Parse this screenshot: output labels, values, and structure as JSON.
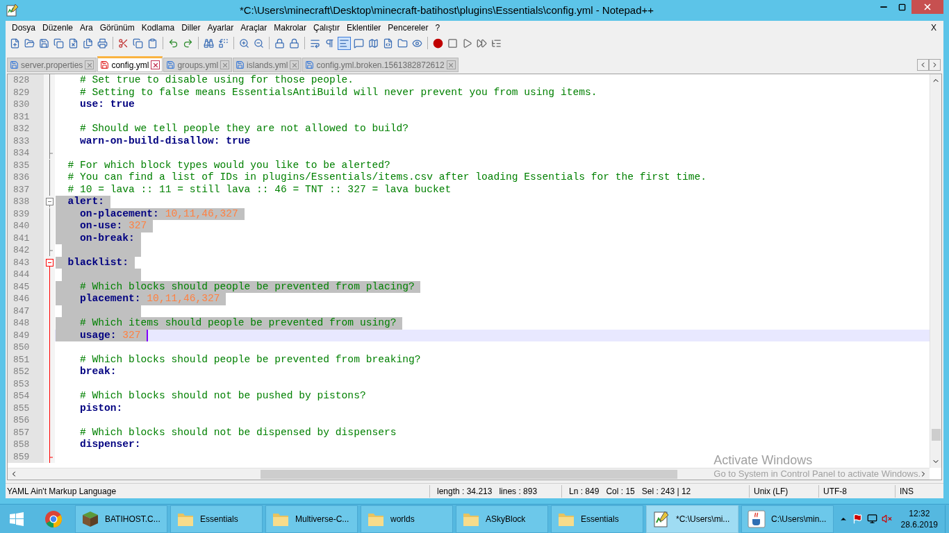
{
  "window": {
    "title": "*C:\\Users\\minecraft\\Desktop\\minecraft-batihost\\plugins\\Essentials\\config.yml - Notepad++"
  },
  "menu": {
    "items": [
      "Dosya",
      "Düzenle",
      "Ara",
      "Görünüm",
      "Kodlama",
      "Diller",
      "Ayarlar",
      "Araçlar",
      "Makrolar",
      "Çalıştır",
      "Eklentiler",
      "Pencereler",
      "?"
    ],
    "close": "X"
  },
  "tabs": [
    {
      "label": "server.properties",
      "selected": false,
      "modified": false
    },
    {
      "label": "config.yml",
      "selected": true,
      "modified": true
    },
    {
      "label": "groups.yml",
      "selected": false,
      "modified": false
    },
    {
      "label": "islands.yml",
      "selected": false,
      "modified": false
    },
    {
      "label": "config.yml.broken.1561382872612",
      "selected": false,
      "modified": false
    }
  ],
  "editor": {
    "lines": [
      {
        "number": "828",
        "fold_start": false,
        "fold_end": false,
        "fold_active": false,
        "selected": false,
        "current": false,
        "segments": [
          {
            "kind": "comment",
            "text": "    # Set true to disable using for those people."
          }
        ]
      },
      {
        "number": "829",
        "fold_start": false,
        "fold_end": false,
        "fold_active": false,
        "selected": false,
        "current": false,
        "segments": [
          {
            "kind": "comment",
            "text": "    # Setting to false means EssentialsAntiBuild will never prevent you from using items."
          }
        ]
      },
      {
        "number": "830",
        "fold_start": false,
        "fold_end": false,
        "fold_active": false,
        "selected": false,
        "current": false,
        "segments": [
          {
            "kind": "key",
            "text": "    use:"
          },
          {
            "kind": "bool",
            "text": " true"
          }
        ]
      },
      {
        "number": "831",
        "fold_start": false,
        "fold_end": false,
        "fold_active": false,
        "selected": false,
        "current": false
      },
      {
        "number": "832",
        "fold_start": false,
        "fold_end": false,
        "fold_active": false,
        "selected": false,
        "current": false,
        "segments": [
          {
            "kind": "comment",
            "text": "    # Should we tell people they are not allowed to build?"
          }
        ]
      },
      {
        "number": "833",
        "fold_start": false,
        "fold_end": false,
        "fold_active": false,
        "selected": false,
        "current": false,
        "segments": [
          {
            "kind": "key",
            "text": "    warn-on-build-disallow:"
          },
          {
            "kind": "bool",
            "text": " true"
          }
        ]
      },
      {
        "number": "834",
        "fold_start": false,
        "fold_end": true,
        "fold_active": false,
        "selected": false,
        "current": false
      },
      {
        "number": "835",
        "fold_start": false,
        "fold_end": false,
        "fold_active": false,
        "selected": false,
        "current": false,
        "segments": [
          {
            "kind": "comment",
            "text": "  # For which block types would you like to be alerted?"
          }
        ]
      },
      {
        "number": "836",
        "fold_start": false,
        "fold_end": false,
        "fold_active": false,
        "selected": false,
        "current": false,
        "segments": [
          {
            "kind": "comment",
            "text": "  # You can find a list of IDs in plugins/Essentials/items.csv after loading Essentials for the first time."
          }
        ]
      },
      {
        "number": "837",
        "fold_start": false,
        "fold_end": false,
        "fold_active": false,
        "selected": false,
        "current": false,
        "segments": [
          {
            "kind": "comment",
            "text": "  # 10 = lava :: 11 = still lava :: 46 = TNT :: 327 = lava bucket"
          }
        ]
      },
      {
        "number": "838",
        "fold_start": true,
        "fold_end": false,
        "fold_active": false,
        "selected": true,
        "current": false,
        "segments": [
          {
            "kind": "key",
            "text": "  alert:"
          }
        ]
      },
      {
        "number": "839",
        "fold_start": false,
        "fold_end": false,
        "fold_active": false,
        "selected": true,
        "current": false,
        "segments": [
          {
            "kind": "key",
            "text": "    on-placement:"
          },
          {
            "kind": "value",
            "text": " 10,11,46,327"
          }
        ]
      },
      {
        "number": "840",
        "fold_start": false,
        "fold_end": false,
        "fold_active": false,
        "selected": true,
        "current": false,
        "segments": [
          {
            "kind": "key",
            "text": "    on-use:"
          },
          {
            "kind": "value",
            "text": " 327"
          }
        ]
      },
      {
        "number": "841",
        "fold_start": false,
        "fold_end": false,
        "fold_active": false,
        "selected": true,
        "current": false,
        "segments": [
          {
            "kind": "key",
            "text": "    on-break:"
          }
        ]
      },
      {
        "number": "842",
        "fold_start": false,
        "fold_end": true,
        "fold_active": false,
        "selected": true,
        "current": false
      },
      {
        "number": "843",
        "fold_start": true,
        "fold_end": false,
        "fold_active": true,
        "selected": true,
        "current": false,
        "segments": [
          {
            "kind": "key",
            "text": "  blacklist:"
          }
        ]
      },
      {
        "number": "844",
        "fold_start": false,
        "fold_end": false,
        "fold_active": true,
        "selected": true,
        "current": false
      },
      {
        "number": "845",
        "fold_start": false,
        "fold_end": false,
        "fold_active": true,
        "selected": true,
        "current": false,
        "segments": [
          {
            "kind": "comment",
            "text": "    # Which blocks should people be prevented from placing?"
          }
        ]
      },
      {
        "number": "846",
        "fold_start": false,
        "fold_end": false,
        "fold_active": true,
        "selected": true,
        "current": false,
        "segments": [
          {
            "kind": "key",
            "text": "    placement:"
          },
          {
            "kind": "value",
            "text": " 10,11,46,327"
          }
        ]
      },
      {
        "number": "847",
        "fold_start": false,
        "fold_end": false,
        "fold_active": true,
        "selected": true,
        "current": false
      },
      {
        "number": "848",
        "fold_start": false,
        "fold_end": false,
        "fold_active": true,
        "selected": true,
        "current": false,
        "segments": [
          {
            "kind": "comment",
            "text": "    # Which items should people be prevented from using?"
          }
        ]
      },
      {
        "number": "849",
        "fold_start": false,
        "fold_end": false,
        "fold_active": true,
        "selected": true,
        "current": true,
        "segments": [
          {
            "kind": "key",
            "text": "    usage:"
          },
          {
            "kind": "value",
            "text": " 327"
          }
        ]
      },
      {
        "number": "850",
        "fold_start": false,
        "fold_end": false,
        "fold_active": true,
        "selected": false,
        "current": false
      },
      {
        "number": "851",
        "fold_start": false,
        "fold_end": false,
        "fold_active": true,
        "selected": false,
        "current": false,
        "segments": [
          {
            "kind": "comment",
            "text": "    # Which blocks should people be prevented from breaking?"
          }
        ]
      },
      {
        "number": "852",
        "fold_start": false,
        "fold_end": false,
        "fold_active": true,
        "selected": false,
        "current": false,
        "segments": [
          {
            "kind": "key",
            "text": "    break:"
          }
        ]
      },
      {
        "number": "853",
        "fold_start": false,
        "fold_end": false,
        "fold_active": true,
        "selected": false,
        "current": false
      },
      {
        "number": "854",
        "fold_start": false,
        "fold_end": false,
        "fold_active": true,
        "selected": false,
        "current": false,
        "segments": [
          {
            "kind": "comment",
            "text": "    # Which blocks should not be pushed by pistons?"
          }
        ]
      },
      {
        "number": "855",
        "fold_start": false,
        "fold_end": false,
        "fold_active": true,
        "selected": false,
        "current": false,
        "segments": [
          {
            "kind": "key",
            "text": "    piston:"
          }
        ]
      },
      {
        "number": "856",
        "fold_start": false,
        "fold_end": false,
        "fold_active": true,
        "selected": false,
        "current": false
      },
      {
        "number": "857",
        "fold_start": false,
        "fold_end": false,
        "fold_active": true,
        "selected": false,
        "current": false,
        "segments": [
          {
            "kind": "comment",
            "text": "    # Which blocks should not be dispensed by dispensers"
          }
        ]
      },
      {
        "number": "858",
        "fold_start": false,
        "fold_end": false,
        "fold_active": true,
        "selected": false,
        "current": false,
        "segments": [
          {
            "kind": "key",
            "text": "    dispenser:"
          }
        ]
      },
      {
        "number": "859",
        "fold_start": false,
        "fold_end": true,
        "fold_active": true,
        "selected": false,
        "current": false
      }
    ]
  },
  "activation_notice": {
    "title": "Activate Windows",
    "text": "Go to System in Control Panel to activate Windows."
  },
  "status_bar": {
    "language": "YAML Ain't Markup Language",
    "length": "length : 34.213",
    "lines": "lines : 893",
    "line": "Ln : 849",
    "column": "Col : 15",
    "selection": "Sel : 243 | 12",
    "eol": "Unix (LF)",
    "encoding": "UTF-8",
    "mode": "INS"
  },
  "taskbar": {
    "items": [
      {
        "kind": "block",
        "label": "BATIHOST.C...",
        "selected": false
      },
      {
        "kind": "folder",
        "label": "Essentials",
        "selected": false
      },
      {
        "kind": "folder",
        "label": "Multiverse-C...",
        "selected": false
      },
      {
        "kind": "folder",
        "label": "worlds",
        "selected": false
      },
      {
        "kind": "folder",
        "label": "ASkyBlock",
        "selected": false
      },
      {
        "kind": "folder",
        "label": "Essentials",
        "selected": false
      },
      {
        "kind": "notepad",
        "label": "*C:\\Users\\mi...",
        "selected": true
      },
      {
        "kind": "java",
        "label": "C:\\Users\\min...",
        "selected": false
      }
    ],
    "time": "12:32",
    "date": "28.6.2019"
  }
}
